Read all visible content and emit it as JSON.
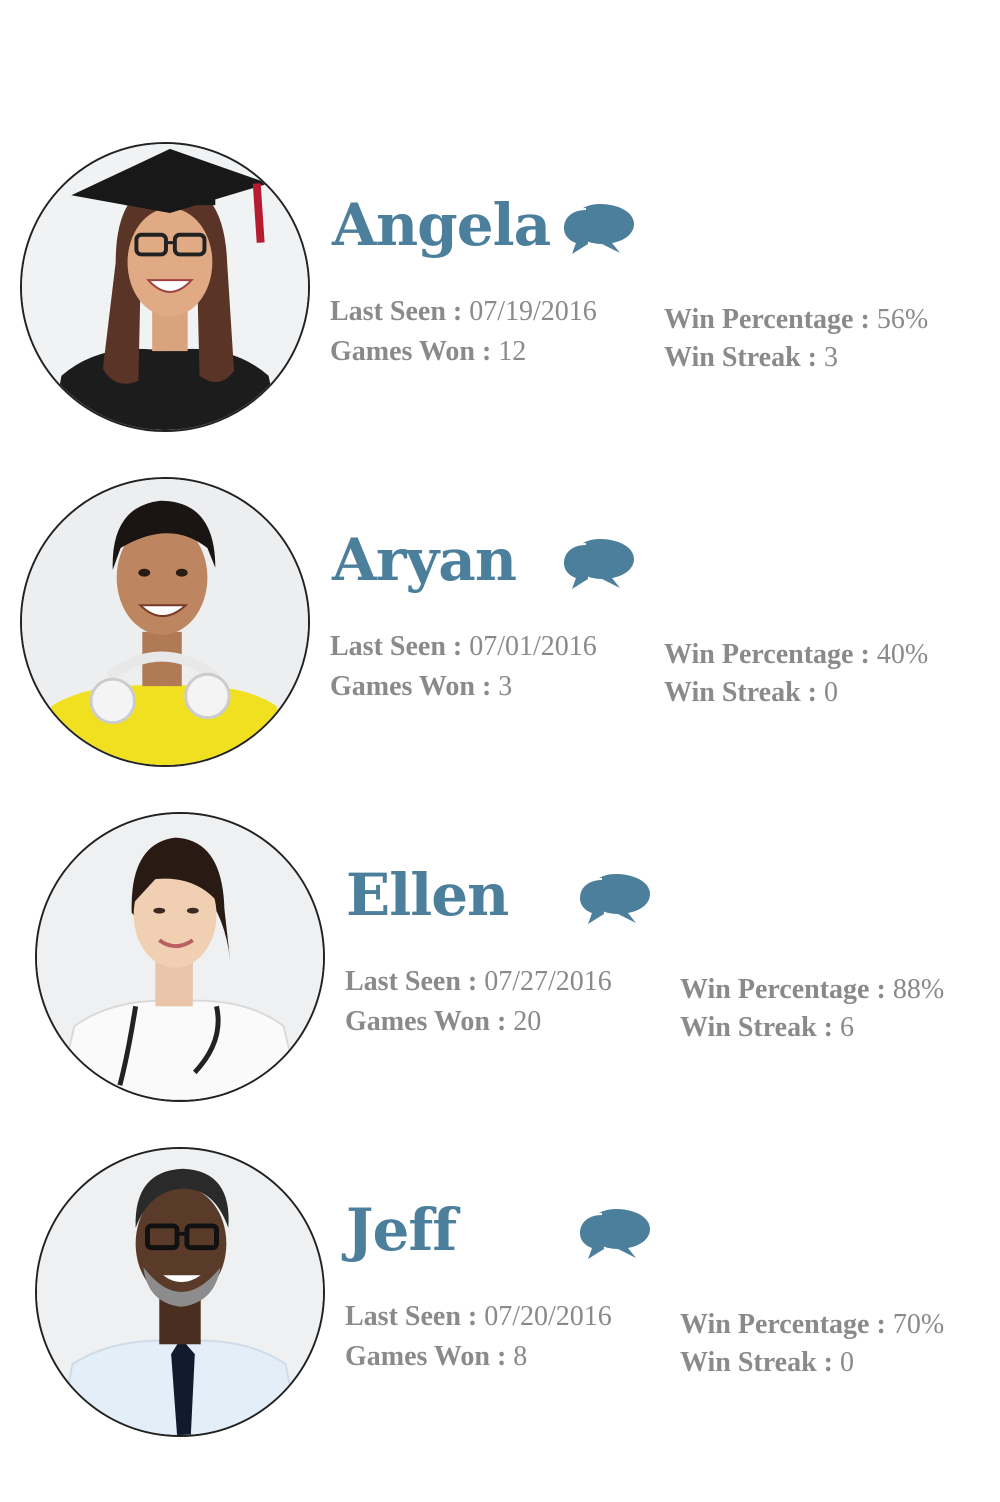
{
  "theme": {
    "accent": "#4b7f9c",
    "stat_text": "#8a8a8a",
    "avatar_border": "#222222"
  },
  "stat_labels": {
    "last_seen": "Last Seen : ",
    "games_won": "Games Won : ",
    "win_percentage": "Win Percentage : ",
    "win_streak": "Win Streak : "
  },
  "players": [
    {
      "name": "Angela",
      "last_seen": "07/19/2016",
      "games_won": "12",
      "win_percentage": "56%",
      "win_streak": "3",
      "avatar_icon": "graduate-photo",
      "chat_icon": "chat-bubbles-icon"
    },
    {
      "name": "Aryan",
      "last_seen": "07/01/2016",
      "games_won": "3",
      "win_percentage": "40%",
      "win_streak": "0",
      "avatar_icon": "student-with-headphones-photo",
      "chat_icon": "chat-bubbles-icon"
    },
    {
      "name": "Ellen",
      "last_seen": "07/27/2016",
      "games_won": "20",
      "win_percentage": "88%",
      "win_streak": "6",
      "avatar_icon": "doctor-photo",
      "chat_icon": "chat-bubbles-icon"
    },
    {
      "name": "Jeff",
      "last_seen": "07/20/2016",
      "games_won": "8",
      "win_percentage": "70%",
      "win_streak": "0",
      "avatar_icon": "businessman-with-glasses-photo",
      "chat_icon": "chat-bubbles-icon"
    }
  ]
}
